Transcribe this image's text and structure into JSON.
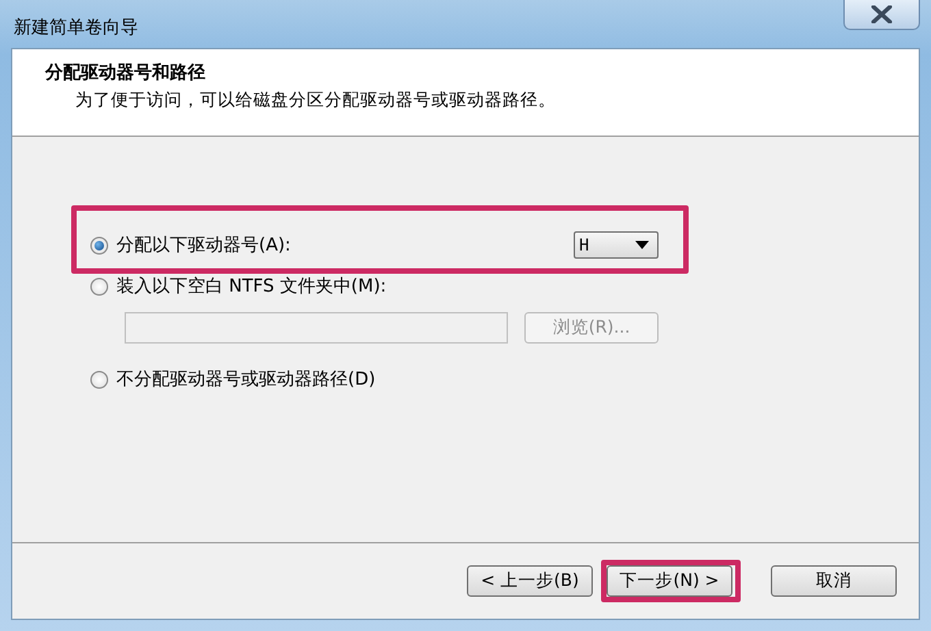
{
  "window": {
    "title": "新建简单卷向导"
  },
  "header": {
    "title": "分配驱动器号和路径",
    "subtitle": "为了便于访问，可以给磁盘分区分配驱动器号或驱动器路径。"
  },
  "options": [
    {
      "kind": "drive",
      "label": "分配以下驱动器号(A):",
      "selected": true,
      "highlighted": true,
      "value": "H"
    },
    {
      "kind": "folder",
      "label": "装入以下空白 NTFS 文件夹中(M):",
      "selected": false,
      "highlighted": false,
      "browse": {
        "label": "浏览(R)...",
        "disabled": true
      },
      "field_disabled": true
    },
    {
      "kind": "none",
      "label": "不分配驱动器号或驱动器路径(D)",
      "selected": false,
      "highlighted": false
    }
  ],
  "buttons": [
    {
      "label": "< 上一步(B)",
      "highlighted": false
    },
    {
      "label": "下一步(N) >",
      "highlighted": true
    },
    {
      "label": "取消",
      "highlighted": false
    }
  ]
}
